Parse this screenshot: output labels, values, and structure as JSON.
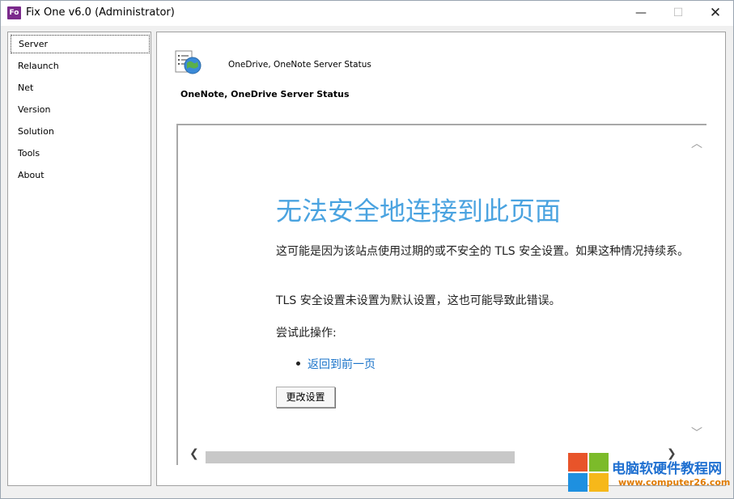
{
  "window": {
    "app_icon": "Fo",
    "title": "Fix One v6.0 (Administrator)",
    "minimize_glyph": "—",
    "maximize_glyph": "☐",
    "close_glyph": "✕"
  },
  "sidebar": {
    "items": [
      {
        "label": "Server",
        "selected": true
      },
      {
        "label": "Relaunch"
      },
      {
        "label": "Net"
      },
      {
        "label": "Version"
      },
      {
        "label": "Solution"
      },
      {
        "label": "Tools"
      },
      {
        "label": "About"
      }
    ]
  },
  "main": {
    "icon": "globe-document-icon",
    "header_label": "OneDrive, OneNote Server Status",
    "section_title": "OneNote, OneDrive Server Status",
    "browser": {
      "heading": "无法安全地连接到此页面",
      "paragraph1": "这可能是因为该站点使用过期的或不安全的 TLS 安全设置。如果这种情况持续系。",
      "paragraph2": "TLS 安全设置未设置为默认设置，这也可能导致此错误。",
      "paragraph3": "尝试此操作:",
      "link": "返回到前一页",
      "button": "更改设置",
      "scroll_up_glyph": "︿",
      "scroll_down_glyph": "﹀",
      "scroll_left_glyph": "❮",
      "scroll_right_glyph": "❯"
    }
  },
  "watermark": {
    "text1": "电脑软硬件教程网",
    "text2": "www.computer26.com",
    "colors": [
      "#e8542a",
      "#7cbb2a",
      "#1e90e0",
      "#f6b81a"
    ]
  }
}
